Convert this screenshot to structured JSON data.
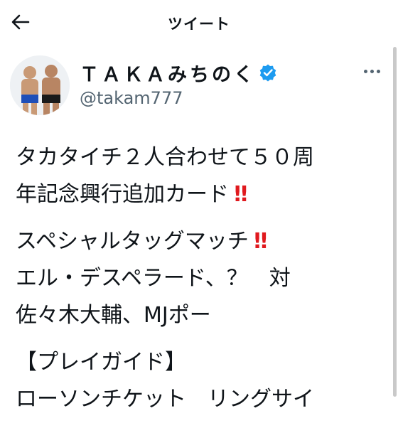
{
  "header": {
    "title": "ツイート",
    "back_icon": "arrow-left-icon"
  },
  "author": {
    "name": "ＴＡＫＡみちのく",
    "handle": "@takam777",
    "verified": true,
    "verified_icon": "verified-badge-icon",
    "more_icon": "more-horizontal-icon"
  },
  "tweet": {
    "paragraphs": [
      {
        "lines": [
          "タカタイチ２人合わせて５０周",
          "年記念興行追加カード"
        ],
        "emoji_line": 1
      },
      {
        "lines": [
          "スペシャルタッグマッチ",
          "エル・デスペラード、？　対",
          "佐々木大輔、MJポー"
        ],
        "emoji_line": 0
      },
      {
        "lines": [
          "【プレイガイド】",
          "ローソンチケット　リングサイ"
        ],
        "emoji_line": -1
      }
    ],
    "emoji": "‼"
  },
  "colors": {
    "text": "#0f1419",
    "secondary": "#536471",
    "verified": "#1d9bf0",
    "emoji": "#e0191e"
  }
}
